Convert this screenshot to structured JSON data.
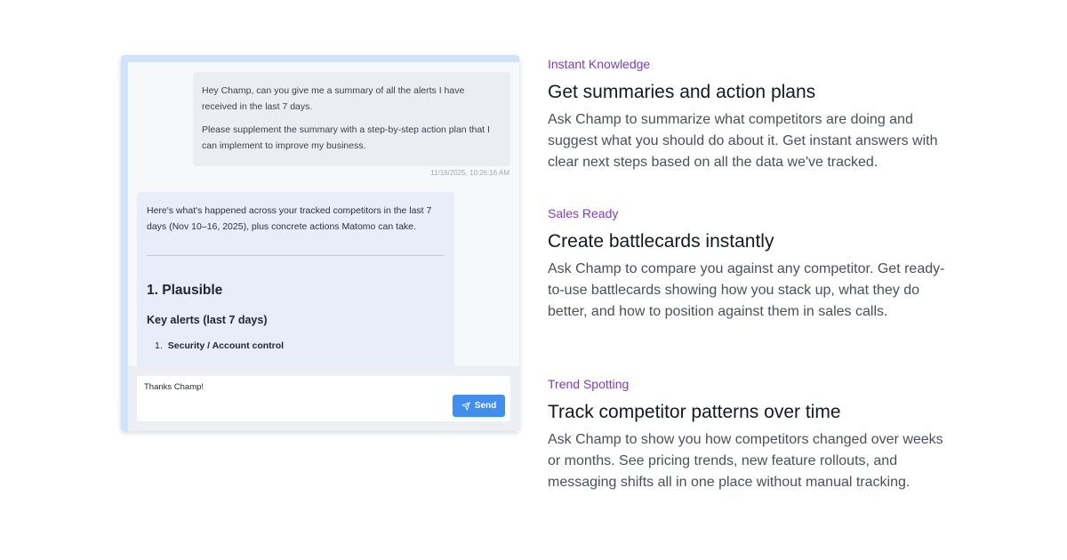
{
  "chat": {
    "user_message": {
      "paragraphs": [
        "Hey Champ, can you give me a summary of all the alerts I have received in the last 7 days.",
        "Please supplement the summary with a step-by-step action plan that I can implement to improve my business."
      ],
      "timestamp": "11/16/2025, 10:26:16 AM"
    },
    "assistant_message": {
      "intro": "Here's what's happened across your tracked competitors in the last 7 days (Nov 10–16, 2025), plus concrete actions Matomo can take.",
      "heading": "1. Plausible",
      "subheading": "Key alerts (last 7 days)",
      "list_items": [
        {
          "number": "1.",
          "text": "Security / Account control"
        }
      ]
    },
    "composer": {
      "value": "Thanks Champ!",
      "send_label": "Send"
    }
  },
  "features": [
    {
      "eyebrow": "Instant Knowledge",
      "title": "Get summaries and action plans",
      "body": "Ask Champ to summarize what competitors are doing and suggest what you should do about it. Get instant answers with clear next steps based on all the data we've tracked."
    },
    {
      "eyebrow": "Sales Ready",
      "title": "Create battlecards instantly",
      "body": "Ask Champ to compare you against any competitor. Get ready-to-use battlecards showing how you stack up, what they do better, and how to position against them in sales calls."
    },
    {
      "eyebrow": "Trend Spotting",
      "title": "Track competitor patterns over time",
      "body": "Ask Champ to show you how competitors changed over weeks or months. See pricing trends, new feature rollouts, and messaging shifts all in one place without manual tracking."
    }
  ],
  "colors": {
    "accent_purple": "#7a3fc4",
    "send_blue": "#3f8ef0",
    "panel_accent": "#cfe3fb"
  },
  "icons": {
    "send": "paper-plane-icon"
  }
}
